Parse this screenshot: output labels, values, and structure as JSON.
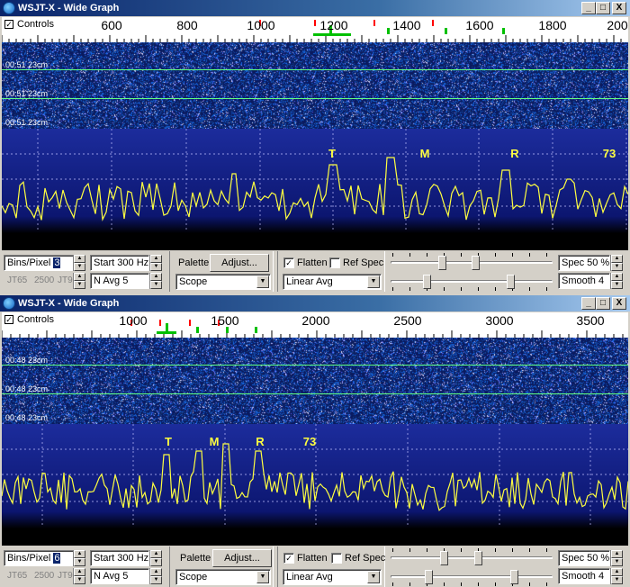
{
  "colors": {
    "spectrum_trace": "#ffff40",
    "waterfall_bg": "#0a1a60",
    "grid_line": "#60ff80",
    "marker_red": "#ff0000",
    "marker_green": "#00c000"
  },
  "windows": [
    {
      "title": "WSJT-X - Wide Graph",
      "buttons": {
        "minimize": "_",
        "maximize": "□",
        "close": "X"
      },
      "controls_label": "Controls",
      "freq_labels": [
        "600",
        "800",
        "1000",
        "1200",
        "1400",
        "1600",
        "1800",
        "200"
      ],
      "timestamps": [
        "00:51   23cm",
        "00:51   23cm",
        "00:51   23cm"
      ],
      "decodes": [
        "T",
        "M",
        "R",
        "73"
      ],
      "bins_per_pixel": {
        "label": "Bins/Pixel",
        "value": "3"
      },
      "start": "Start 300 Hz",
      "modes": [
        "JT65",
        "2500",
        "JT9"
      ],
      "navg": "N Avg 5",
      "palette_label": "Palette",
      "adjust_button": "Adjust...",
      "palette_value": "Scope",
      "flatten": "Flatten",
      "ref_spec": "Ref Spec",
      "avg_mode": "Linear Avg",
      "spec": "Spec 50 %",
      "smooth": "Smooth  4"
    },
    {
      "title": "WSJT-X - Wide Graph",
      "buttons": {
        "minimize": "_",
        "maximize": "□",
        "close": "X"
      },
      "controls_label": "Controls",
      "freq_labels": [
        "1000",
        "1500",
        "2000",
        "2500",
        "3000",
        "3500"
      ],
      "timestamps": [
        "00:48   23cm",
        "00:48   23cm",
        "00:48   23cm"
      ],
      "decodes": [
        "T",
        "M",
        "R",
        "73"
      ],
      "bins_per_pixel": {
        "label": "Bins/Pixel",
        "value": "6"
      },
      "start": "Start 300 Hz",
      "modes": [
        "JT65",
        "2500",
        "JT9"
      ],
      "navg": "N Avg 5",
      "palette_label": "Palette",
      "adjust_button": "Adjust...",
      "palette_value": "Scope",
      "flatten": "Flatten",
      "ref_spec": "Ref Spec",
      "avg_mode": "Linear Avg",
      "spec": "Spec 50 %",
      "smooth": "Smooth  4"
    }
  ]
}
